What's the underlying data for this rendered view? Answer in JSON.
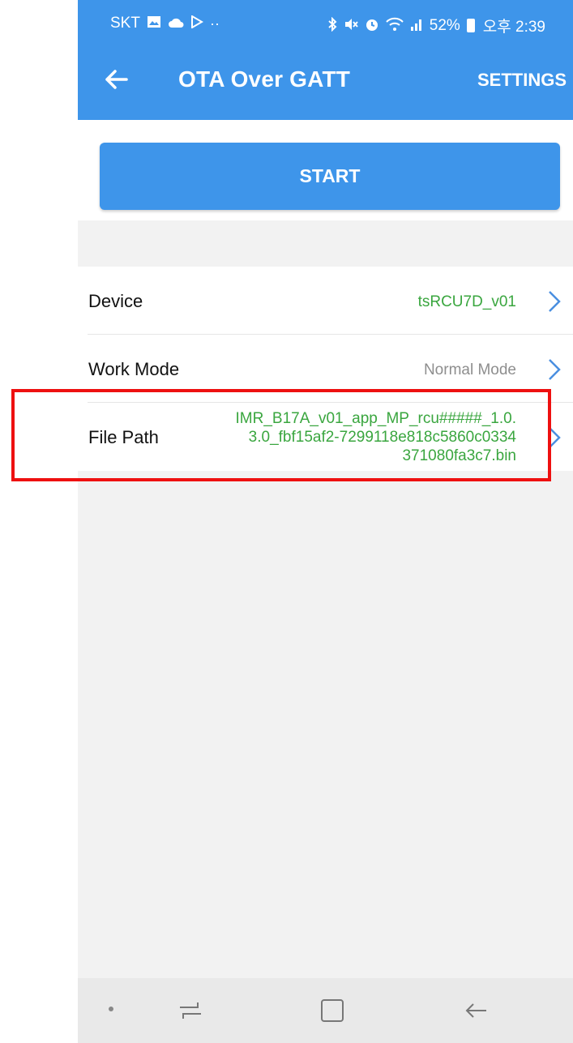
{
  "status_bar": {
    "carrier": "SKT",
    "battery": "52%",
    "time": "오후 2:39",
    "icons_left": [
      "gallery-icon",
      "cloud-icon",
      "play-store-icon",
      "more-icon"
    ],
    "icons_right": [
      "bluetooth-icon",
      "mute-icon",
      "alarm-icon",
      "wifi-icon",
      "signal-icon",
      "battery-icon"
    ]
  },
  "app_bar": {
    "title": "OTA Over GATT",
    "settings_label": "SETTINGS",
    "back_icon": "back-arrow-icon",
    "color": "#3e95ea"
  },
  "actions": {
    "start_label": "START"
  },
  "settings_list": {
    "rows": [
      {
        "label": "Device",
        "value": "tsRCU7D_v01",
        "value_color": "#3aa63f"
      },
      {
        "label": "Work Mode",
        "value": "Normal Mode",
        "value_color": "#8e8e8e"
      },
      {
        "label": "File Path",
        "value_lines": [
          "IMR_B17A_v01_app_MP_rcu#####_1.0.",
          "3.0_fbf15af2-7299118e818c5860c0334",
          "371080fa3c7.bin"
        ],
        "value_color": "#3aa63f"
      }
    ]
  },
  "highlight": {
    "color": "#ee1010",
    "target": "File Path"
  },
  "nav_bar": {
    "icons": [
      "recents-icon",
      "home-icon",
      "back-icon"
    ]
  }
}
